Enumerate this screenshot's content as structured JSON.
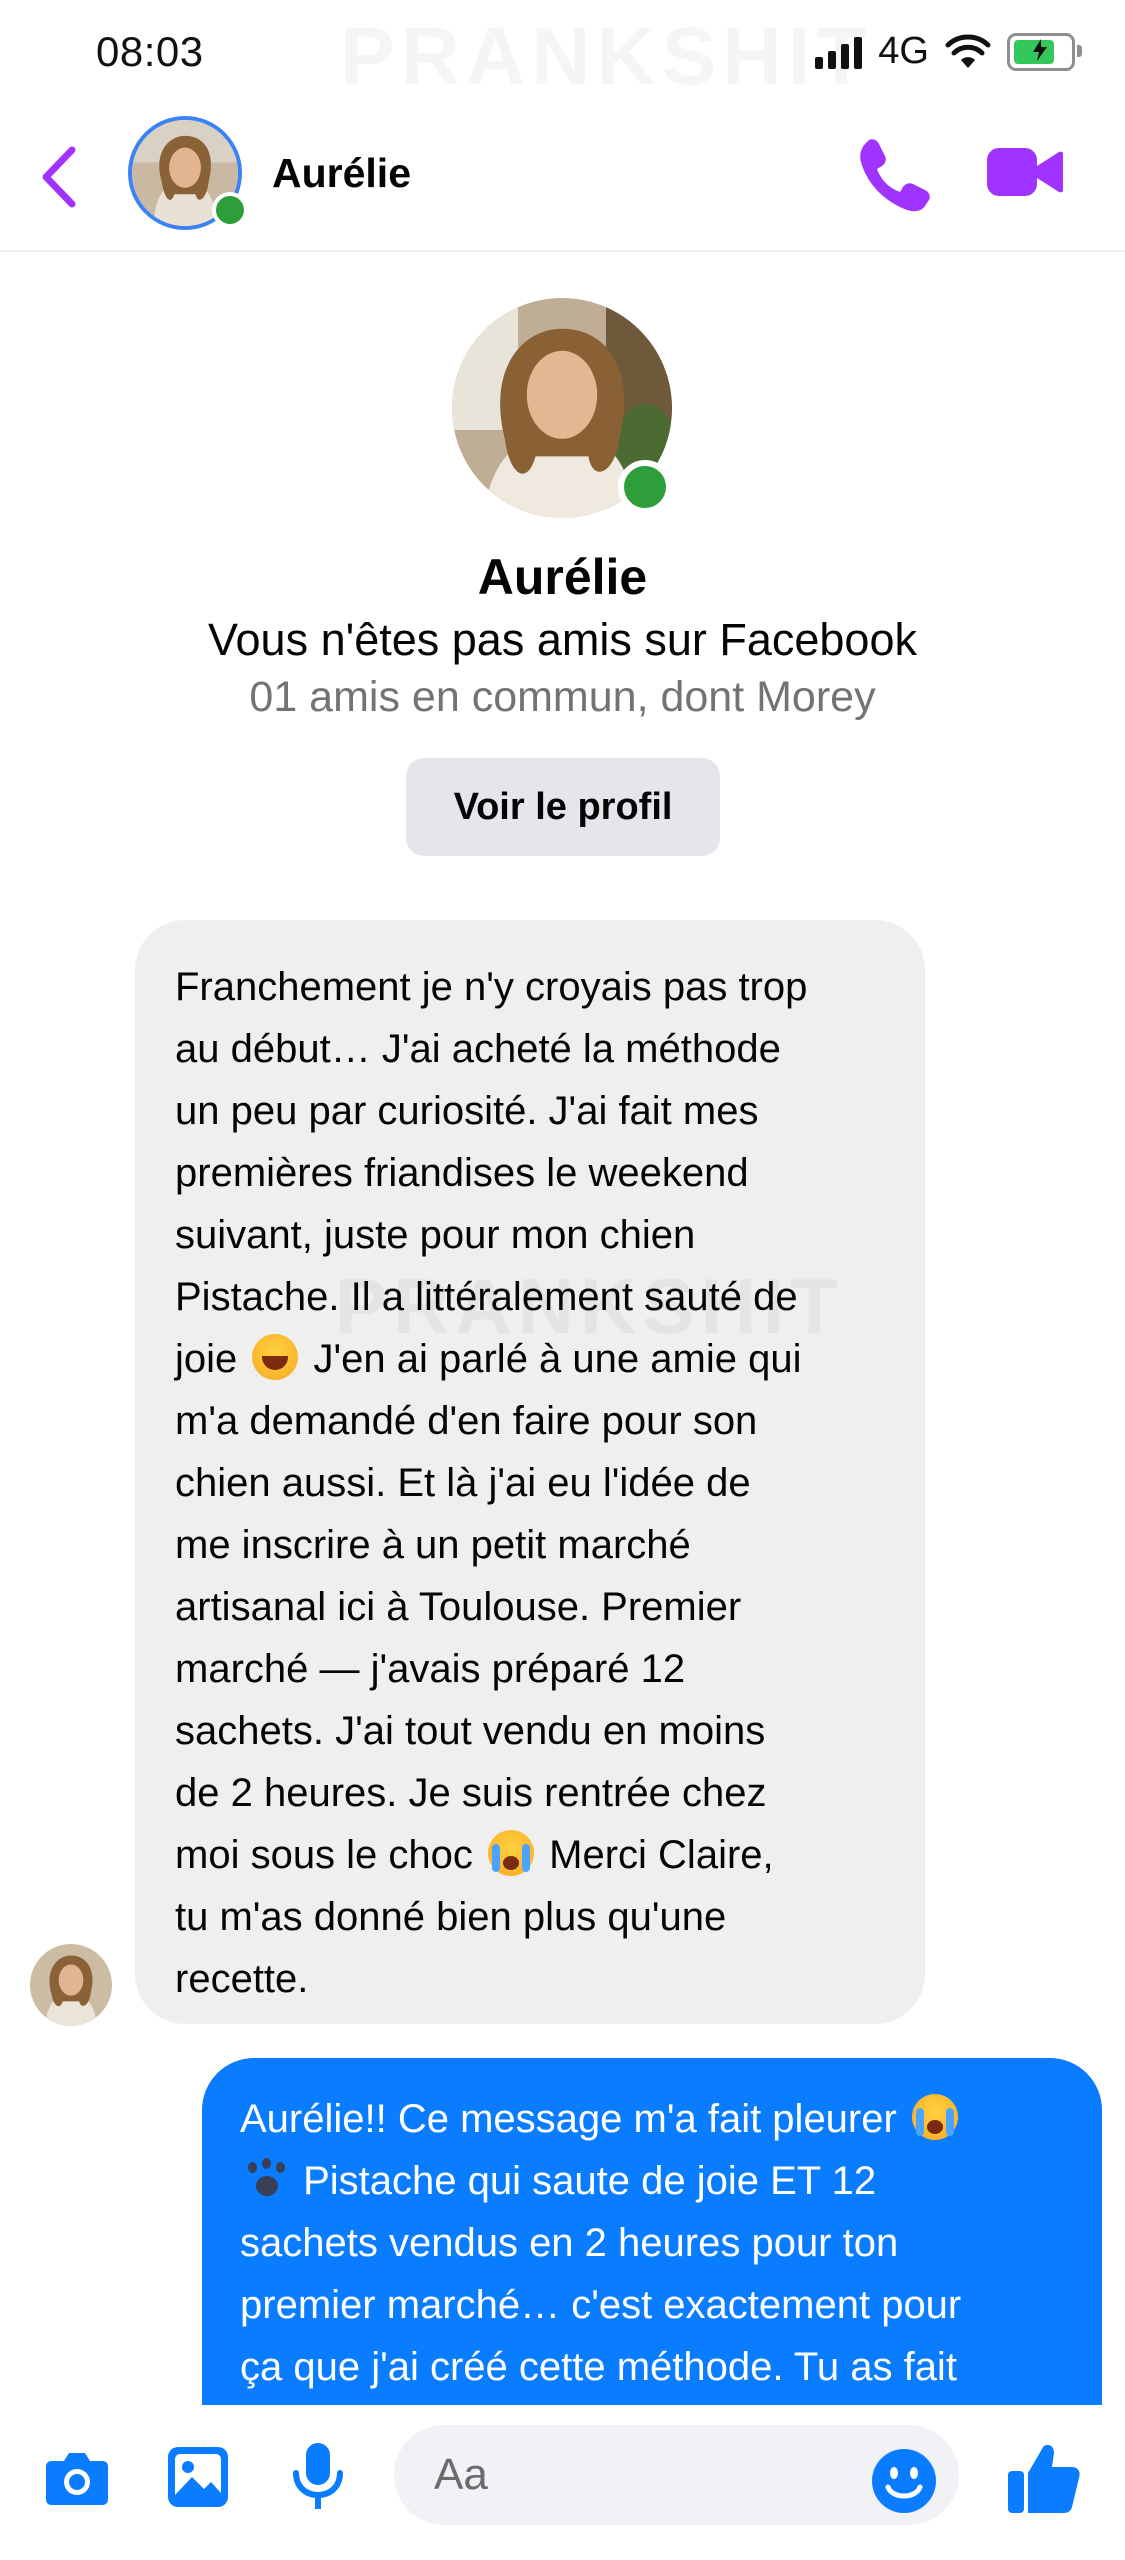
{
  "status_bar": {
    "time": "08:03",
    "network": "4G",
    "watermark": "PRANKSHIT"
  },
  "header": {
    "contact_name": "Aurélie",
    "icons": [
      "back-chevron-icon",
      "phone-icon",
      "video-camera-icon"
    ],
    "accent_color": "#a033ff"
  },
  "profile": {
    "name": "Aurélie",
    "relationship": "Vous n'êtes pas amis sur Facebook",
    "mutual_friends": "01 amis en commun, dont Morey",
    "button_label": "Voir le profil"
  },
  "messages": [
    {
      "direction": "incoming",
      "lines": [
        "Franchement je n'y croyais pas trop",
        "au début… J'ai acheté la méthode",
        "un peu par curiosité. J'ai fait mes",
        "premières friandises le weekend",
        "suivant, juste pour mon chien",
        "Pistache. Il a littéralement sauté de",
        "joie",
        " J'en ai parlé à une amie qui",
        "m'a demandé d'en faire pour son",
        "chien aussi. Et là j'ai eu l'idée de",
        "me inscrire à un petit marché",
        "artisanal ici à Toulouse. Premier",
        "marché — j'avais préparé 12",
        "sachets. J'ai tout vendu en moins",
        "de 2 heures. Je suis rentrée chez",
        "moi sous le choc",
        " Merci Claire,",
        "tu m'as donné bien plus qu'une",
        "recette."
      ]
    },
    {
      "direction": "outgoing",
      "lines": [
        "Aurélie!! Ce message m'a fait pleurer",
        " Pistache qui saute de joie ET 12",
        "sachets vendus en 2 heures pour ton",
        "premier marché… c'est exactement pour",
        "ça que j'ai créé cette méthode. Tu as fait"
      ]
    }
  ],
  "composer": {
    "placeholder": "Aa",
    "icons": [
      "camera-icon",
      "image-icon",
      "microphone-icon",
      "emoji-icon",
      "thumbs-up-icon"
    ],
    "accent_color": "#0a7cff"
  }
}
